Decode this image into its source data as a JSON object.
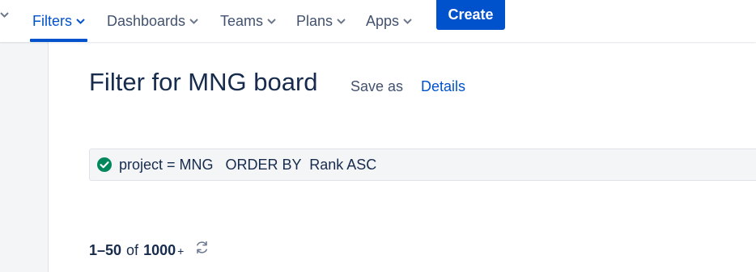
{
  "nav": {
    "items": [
      {
        "label": "Filters",
        "active": true
      },
      {
        "label": "Dashboards"
      },
      {
        "label": "Teams"
      },
      {
        "label": "Plans"
      },
      {
        "label": "Apps"
      }
    ],
    "create_label": "Create"
  },
  "header": {
    "title": "Filter for MNG board",
    "save_as": "Save as",
    "details": "Details"
  },
  "query": {
    "text": "project = MNG   ORDER BY  Rank ASC",
    "status_icon": "check-circle-icon"
  },
  "results": {
    "range": "1–50",
    "of": "of",
    "total": "1000",
    "plus": "+"
  },
  "colors": {
    "accent": "#0052cc",
    "valid": "#00875a",
    "nav_text": "#42526e",
    "text": "#172b4d"
  }
}
